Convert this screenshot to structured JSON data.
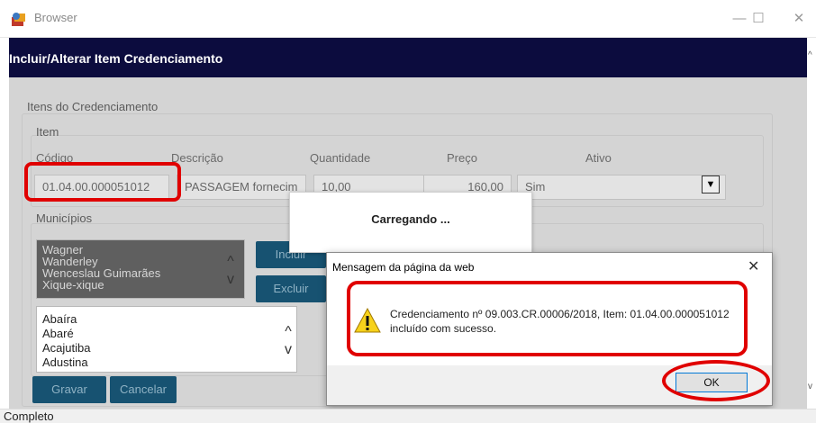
{
  "window": {
    "title": "Browser",
    "minimize_glyph": "—",
    "maximize_glyph": "☐",
    "close_glyph": "✕"
  },
  "page": {
    "title": "Incluir/Alterar Item Credenciamento"
  },
  "form": {
    "group_title": "Itens do Credenciamento",
    "item_title": "Item",
    "labels": {
      "codigo": "Código",
      "descricao": "Descrição",
      "quantidade": "Quantidade",
      "preco": "Preço",
      "ativo": "Ativo"
    },
    "values": {
      "codigo": "01.04.00.000051012",
      "descricao": "PASSAGEM fornecim",
      "quantidade": "10,00",
      "preco": "160,00",
      "ativo": "Sim"
    },
    "municipios_title": "Municípios",
    "selected_list": [
      "Wagner",
      "Wanderley",
      "Wenceslau Guimarães",
      "Xique-xique"
    ],
    "available_list": [
      "Abaíra",
      "Abaré",
      "Acajutiba",
      "Adustina"
    ],
    "btn_incluir": "Incluir",
    "btn_excluir": "Excluir",
    "btn_gravar": "Gravar",
    "btn_cancelar": "Cancelar"
  },
  "loading": {
    "text": "Carregando ..."
  },
  "message_dialog": {
    "title": "Mensagem da página da web",
    "text": "Credenciamento nº 09.003.CR.00006/2018, Item: 01.04.00.000051012 incluído com sucesso.",
    "ok_label": "OK"
  },
  "status": {
    "text": "Completo"
  },
  "colors": {
    "header": "#0c0c3e",
    "button": "#175271",
    "annotation": "#e00000"
  }
}
